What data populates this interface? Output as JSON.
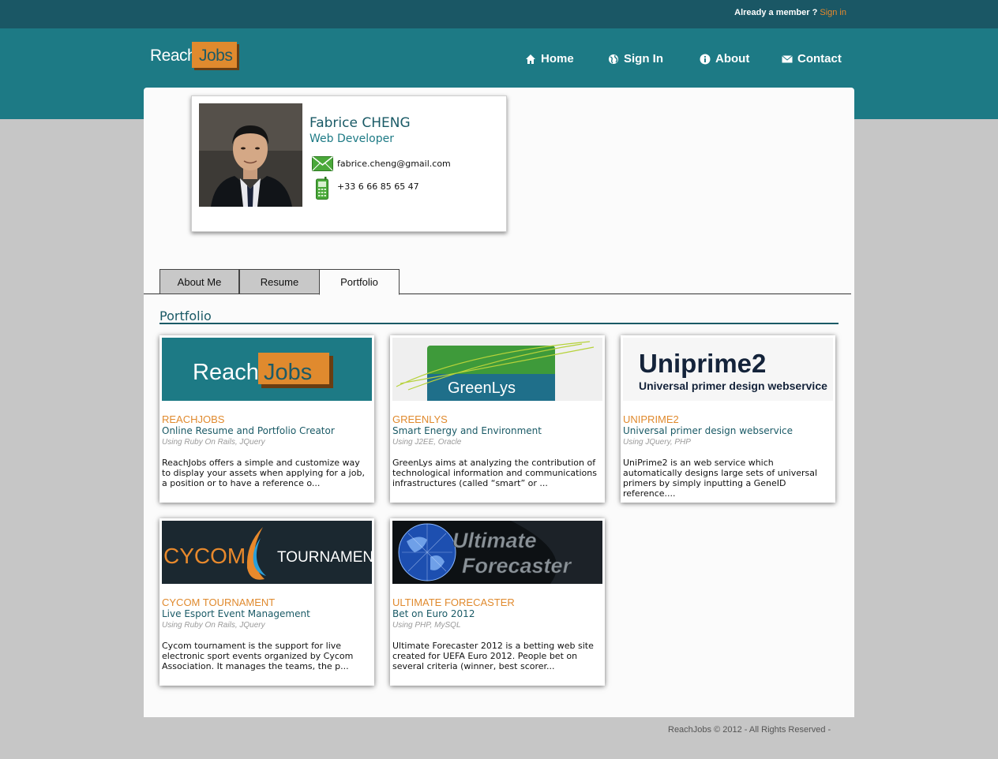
{
  "topbar": {
    "member_text": "Already a member ?",
    "signin_link": "Sign in"
  },
  "logo": {
    "reach": "Reach",
    "jobs": "Jobs"
  },
  "nav": [
    {
      "label": "Home",
      "icon": "home-icon"
    },
    {
      "label": "Sign In",
      "icon": "globe-icon"
    },
    {
      "label": "About",
      "icon": "info-icon"
    },
    {
      "label": "Contact",
      "icon": "mail-icon"
    }
  ],
  "profile": {
    "name": "Fabrice CHENG",
    "title": "Web Developer",
    "email": "fabrice.cheng@gmail.com",
    "phone": "+33 6 66 85 65 47"
  },
  "tabs": [
    {
      "label": "About Me",
      "active": false
    },
    {
      "label": "Resume",
      "active": false
    },
    {
      "label": "Portfolio",
      "active": true
    }
  ],
  "section": {
    "title": "Portfolio"
  },
  "projects": [
    {
      "title": "REACHJOBS",
      "subtitle": "Online Resume and Portfolio Creator",
      "tech": "Using Ruby On Rails, JQuery",
      "desc": "ReachJobs offers a simple and customize way to display your assets when applying for a job, a position or to have a reference o...",
      "thumb_text_1": "Reach",
      "thumb_text_2": "Jobs"
    },
    {
      "title": "GREENLYS",
      "subtitle": "Smart Energy and Environment",
      "tech": "Using J2EE, Oracle",
      "desc": "GreenLys aims at analyzing the contribution of technological information and communications infrastructures (called “smart” or ...",
      "thumb_text_1": "GreenLys"
    },
    {
      "title": "UNIPRIME2",
      "subtitle": "Universal primer design webservice",
      "tech": "Using JQuery, PHP",
      "desc": "UniPrime2 is an web service which automatically designs large sets of universal primers by simply inputting a GeneID reference....",
      "thumb_text_1": "Uniprime2",
      "thumb_text_2": "Universal primer design webservice"
    },
    {
      "title": "CYCOM TOURNAMENT",
      "subtitle": "Live Esport Event Management",
      "tech": "Using Ruby On Rails, JQuery",
      "desc": "Cycom tournament is the support for live electronic sport events organized by Cycom Association. It manages the teams, the p...",
      "thumb_text_1": "CYCOM",
      "thumb_text_2": "TOURNAMENT"
    },
    {
      "title": "ULTIMATE FORECASTER",
      "subtitle": "Bet on Euro 2012",
      "tech": "Using PHP, MySQL",
      "desc": "Ultimate Forecaster 2012 is a betting web site created for UEFA Euro 2012. People bet on several criteria (winner, best scorer...",
      "thumb_text_1": "Ultimate",
      "thumb_text_2": "Forecaster"
    }
  ],
  "footer": {
    "text": "ReachJobs © 2012 - All Rights Reserved -"
  },
  "colors": {
    "header": "#1d7a85",
    "topbar": "#1a5765",
    "accent": "#e08a2e",
    "teal_text": "#1a5a66"
  }
}
